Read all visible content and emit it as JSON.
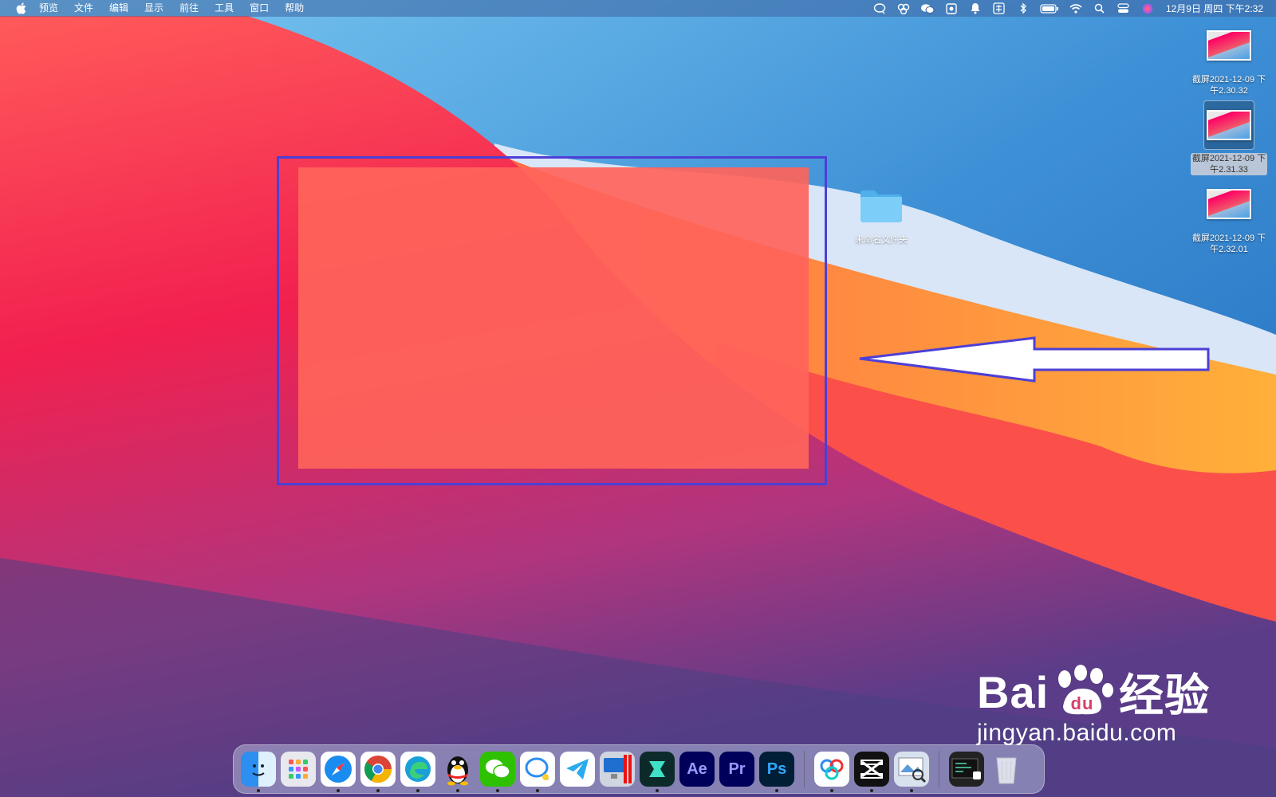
{
  "menubar": {
    "app_menus": [
      "预览",
      "文件",
      "编辑",
      "显示",
      "前往",
      "工具",
      "窗口",
      "帮助"
    ],
    "status_icons": [
      "chat-bubble",
      "baidu-netdisk",
      "wechat",
      "screen-capture",
      "notification-bell",
      "input-method",
      "bluetooth",
      "battery",
      "wifi",
      "spotlight-search",
      "control-center",
      "siri"
    ],
    "clock": "12月9日 周四 下午2:32"
  },
  "desktop": {
    "files": [
      {
        "name": "截屏2021-12-09 下午2.30.32",
        "line1": "截屏2021-12-09 下",
        "line2": "午2.30.32",
        "selected": false
      },
      {
        "name": "截屏2021-12-09 下午2.31.33",
        "line1": "截屏2021-12-09 下",
        "line2": "午2.31.33",
        "selected": true
      },
      {
        "name": "截屏2021-12-09 下午2.32.01",
        "line1": "截屏2021-12-09 下",
        "line2": "午2.32.01",
        "selected": false
      }
    ],
    "folder": {
      "label": "未命名文件夹"
    }
  },
  "annotation": {
    "box_color": "#4d3fd6",
    "arrow_stroke": "#4d3fd6"
  },
  "dock": {
    "apps": [
      {
        "name": "Finder",
        "icon": "finder-icon",
        "label": "",
        "running": true
      },
      {
        "name": "Launchpad",
        "icon": "launchpad-icon",
        "label": "",
        "running": false
      },
      {
        "name": "Safari",
        "icon": "safari-icon",
        "label": "",
        "running": true
      },
      {
        "name": "Chrome",
        "icon": "chrome-icon",
        "label": "",
        "running": true
      },
      {
        "name": "Edge",
        "icon": "edge-icon",
        "label": "",
        "running": true
      },
      {
        "name": "QQ",
        "icon": "qq-icon",
        "label": "",
        "running": true
      },
      {
        "name": "WeChat",
        "icon": "wechat-icon",
        "label": "",
        "running": true
      },
      {
        "name": "Messages",
        "icon": "messages-icon",
        "label": "",
        "running": true
      },
      {
        "name": "Telegram",
        "icon": "telegram-icon",
        "label": "",
        "running": false
      },
      {
        "name": "Parallels",
        "icon": "parallels-icon",
        "label": "",
        "running": false
      },
      {
        "name": "Filmora",
        "icon": "filmora-icon",
        "label": "",
        "running": true
      },
      {
        "name": "After Effects",
        "icon": "after-effects-icon",
        "label": "Ae",
        "running": false
      },
      {
        "name": "Premiere Pro",
        "icon": "premiere-icon",
        "label": "Pr",
        "running": false
      },
      {
        "name": "Photoshop",
        "icon": "photoshop-icon",
        "label": "Ps",
        "running": true
      }
    ],
    "apps_right": [
      {
        "name": "Baidu Netdisk",
        "icon": "baidu-netdisk-icon",
        "label": "",
        "running": true
      },
      {
        "name": "CapCut",
        "icon": "capcut-icon",
        "label": "",
        "running": true
      },
      {
        "name": "Preview",
        "icon": "preview-icon",
        "label": "",
        "running": true
      }
    ],
    "apps_far_right": [
      {
        "name": "Recent Window",
        "icon": "recent-window-icon",
        "label": ""
      },
      {
        "name": "Trash",
        "icon": "trash-icon",
        "label": ""
      }
    ]
  },
  "watermark": {
    "brand_left": "Bai",
    "brand_right": "经验",
    "url": "jingyan.baidu.com"
  }
}
